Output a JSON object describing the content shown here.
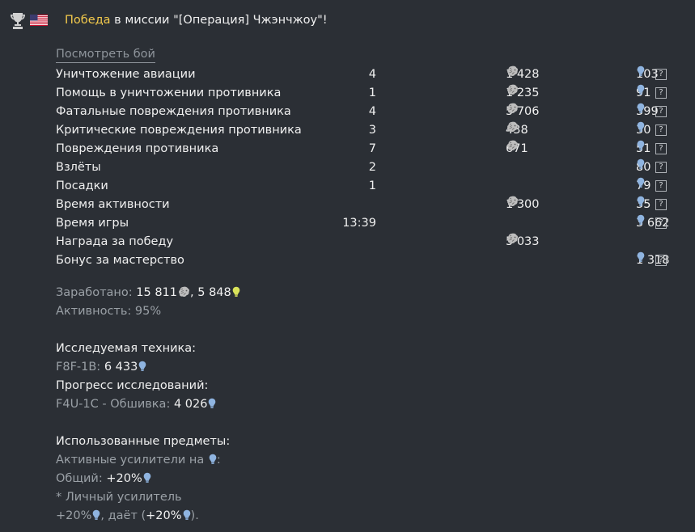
{
  "header": {
    "win_word": "Победа",
    "mission_text": " в миссии \"[Операция] Чжэнчжоу\"!",
    "trophy_icon": "trophy-icon",
    "flag_icon": "usa-flag-icon"
  },
  "view_battle_link": "Посмотреть бой",
  "rows": [
    {
      "label": "Уничтожение авиации",
      "count": "4",
      "lions": "1 428",
      "rp": "103",
      "help": true
    },
    {
      "label": "Помощь в уничтожении противника",
      "count": "1",
      "lions": "1 235",
      "rp": "91",
      "help": true
    },
    {
      "label": "Фатальные повреждения противника",
      "count": "4",
      "lions": "5 706",
      "rp": "399",
      "help": true
    },
    {
      "label": "Критические повреждения противника",
      "count": "3",
      "lions": "438",
      "rp": "30",
      "help": true
    },
    {
      "label": "Повреждения противника",
      "count": "7",
      "lions": "671",
      "rp": "51",
      "help": true
    },
    {
      "label": "Взлёты",
      "count": "2",
      "lions": "",
      "rp": "80",
      "help": true
    },
    {
      "label": "Посадки",
      "count": "1",
      "lions": "",
      "rp": "79",
      "help": true
    },
    {
      "label": "Время активности",
      "count": "",
      "lions": "1 300",
      "rp": "35",
      "help": true
    },
    {
      "label": "Время игры",
      "count": "13:39",
      "lions": "",
      "rp": "3 662",
      "help": true
    },
    {
      "label": "Награда за победу",
      "count": "",
      "lions": "5 033",
      "rp": "",
      "help": false
    },
    {
      "label": "Бонус за мастерство",
      "count": "",
      "lions": "",
      "rp": "1 318",
      "help": true
    }
  ],
  "summary": {
    "earned_label": "Заработано: ",
    "earned_lions": "15 811",
    "earned_sep": ", ",
    "earned_rp": "5 848",
    "activity": "Активность: 95%"
  },
  "research": {
    "title": "Исследуемая техника:",
    "vehicle_label": "F8F-1B: ",
    "vehicle_rp": "6 433",
    "progress_title": "Прогресс исследований:",
    "mod_label": "F4U-1C - Обшивка: ",
    "mod_rp": "4 026"
  },
  "items": {
    "title": "Использованные предметы:",
    "boosters_label": "Активные усилители на ",
    "boosters_end": ":",
    "total_label": "Общий: ",
    "total_value": "+20%",
    "personal_label": "* Личный усилитель",
    "personal_value": "+20%",
    "gives_text": ", даёт (",
    "gives_value": "+20%",
    "gives_end": ")."
  },
  "colors": {
    "accent": "#f2c94c",
    "rp_icon": "#8fb4e0",
    "free_rp_icon": "#d9e35a",
    "lions_icon": "#c9c9c9"
  }
}
